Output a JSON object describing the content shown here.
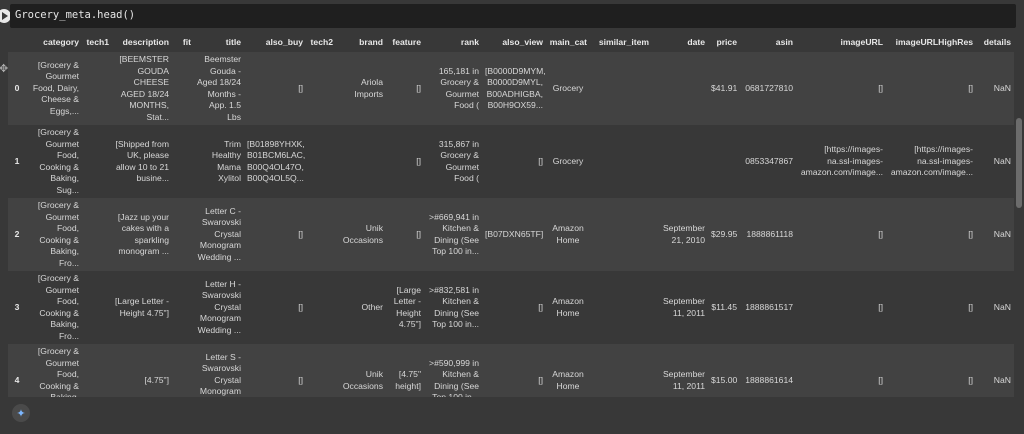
{
  "code": "Grocery_meta.head()",
  "output_icon": "✥",
  "magic_icon": "✦",
  "columns": [
    "",
    "category",
    "tech1",
    "description",
    "fit",
    "title",
    "also_buy",
    "tech2",
    "brand",
    "feature",
    "rank",
    "also_view",
    "main_cat",
    "similar_item",
    "date",
    "price",
    "asin",
    "imageURL",
    "imageURLHighRes",
    "details"
  ],
  "rows": [
    [
      "0",
      "[Grocery & Gourmet Food, Dairy, Cheese & Eggs,...",
      "",
      "[BEEMSTER GOUDA CHEESE AGED 18/24 MONTHS, Stat...",
      "",
      "Beemster Gouda - Aged 18/24 Months - App. 1.5 Lbs",
      "[]",
      "",
      "Ariola Imports",
      "[]",
      "165,181 in Grocery & Gourmet Food (",
      "[B0000D9MYM, B0000D9MYL, B00ADHIGBA, B00H9OX59...",
      "Grocery",
      "",
      "",
      "$41.91",
      "0681727810",
      "[]",
      "[]",
      "NaN"
    ],
    [
      "1",
      "[Grocery & Gourmet Food, Cooking & Baking, Sug...",
      "",
      "[Shipped from UK, please allow 10 to 21 busine...",
      "",
      "Trim Healthy Mama Xylitol",
      "[B01898YHXK, B01BCM6LAC, B00Q4OL47O, B00Q4OL5Q...",
      "",
      "",
      "[]",
      "315,867 in Grocery & Gourmet Food (",
      "[]",
      "Grocery",
      "",
      "",
      "",
      "0853347867",
      "[https://images-na.ssl-images-amazon.com/image...",
      "[https://images-na.ssl-images-amazon.com/image...",
      "NaN"
    ],
    [
      "2",
      "[Grocery & Gourmet Food, Cooking & Baking, Fro...",
      "",
      "[Jazz up your cakes with a sparkling monogram ...",
      "",
      "Letter C - Swarovski Crystal Monogram Wedding ...",
      "[]",
      "",
      "Unik Occasions",
      "[]",
      ">#669,941 in Kitchen & Dining (See Top 100 in...",
      "[B07DXN65TF]",
      "Amazon Home",
      "",
      "September 21, 2010",
      "$29.95",
      "1888861118",
      "[]",
      "[]",
      "NaN"
    ],
    [
      "3",
      "[Grocery & Gourmet Food, Cooking & Baking, Fro...",
      "",
      "[Large Letter - Height 4.75\"]",
      "",
      "Letter H - Swarovski Crystal Monogram Wedding ...",
      "[]",
      "",
      "Other",
      "[Large Letter - Height 4.75\"]",
      ">#832,581 in Kitchen & Dining (See Top 100 in...",
      "[]",
      "Amazon Home",
      "",
      "September 11, 2011",
      "$11.45",
      "1888861517",
      "[]",
      "[]",
      "NaN"
    ],
    [
      "4",
      "[Grocery & Gourmet Food, Cooking & Baking, Fro...",
      "",
      "[4.75\"]",
      "",
      "Letter S - Swarovski Crystal Monogram Wedding ...",
      "[]",
      "",
      "Unik Occasions",
      "[4.75\" height]",
      ">#590,999 in Kitchen & Dining (See Top 100 in...",
      "[]",
      "Amazon Home",
      "",
      "September 11, 2011",
      "$15.00",
      "1888861614",
      "[]",
      "[]",
      "NaN"
    ]
  ]
}
